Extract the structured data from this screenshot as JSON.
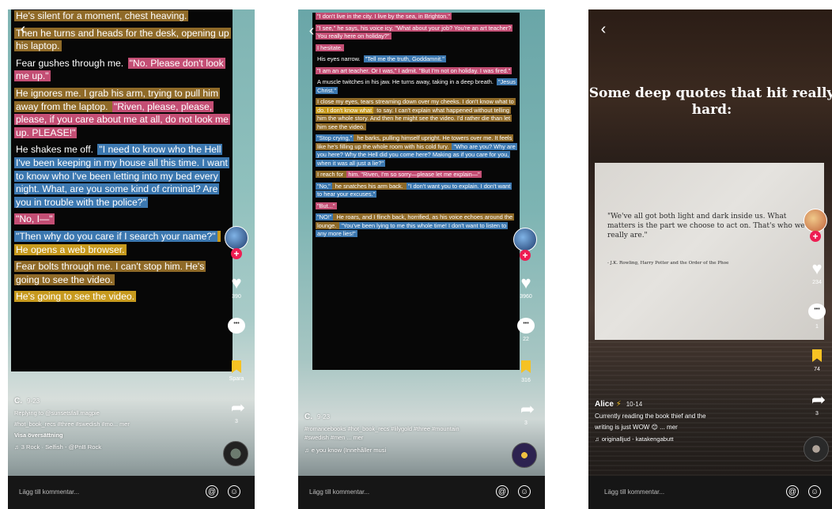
{
  "phones": [
    {
      "text_blocks": [
        {
          "parts": [
            {
              "t": "He's silent for a moment, chest heaving.",
              "hl": "brown"
            }
          ]
        },
        {
          "parts": [
            {
              "t": "Then he turns and heads for the desk, opening up his laptop.",
              "hl": "brown"
            }
          ]
        },
        {
          "parts": [
            {
              "t": "Fear gushes through me. ",
              "hl": "none"
            },
            {
              "t": "\"No. Please don't look me up.\"",
              "hl": "pink"
            }
          ]
        },
        {
          "parts": [
            {
              "t": "He ignores me. I grab his arm, trying to pull him away from the laptop. ",
              "hl": "brown"
            },
            {
              "t": "\"Riven, please, please, please, if you care about me at all, do not look me up. PLEASE!\"",
              "hl": "pink"
            }
          ]
        },
        {
          "parts": [
            {
              "t": "He shakes me off. ",
              "hl": "none"
            },
            {
              "t": "\"I need to know who the Hell I've been keeping in my house all this time. I want to know who I've been letting into my bed every night. What, are you some kind of criminal? Are you in trouble with the police?\"",
              "hl": "blue"
            }
          ]
        },
        {
          "parts": [
            {
              "t": "\"No, I—\"",
              "hl": "pink"
            }
          ]
        },
        {
          "parts": [
            {
              "t": "\"Then why do you care if I search your name?\"",
              "hl": "blue"
            },
            {
              "t": " He opens a web browser.",
              "hl": "yellow"
            }
          ]
        },
        {
          "parts": [
            {
              "t": "Fear bolts through me. I can't stop him. He's going to see the video.",
              "hl": "brown"
            }
          ]
        },
        {
          "parts": [
            {
              "t": "He's going to see the video.",
              "hl": "yellow"
            }
          ]
        }
      ],
      "likes": "390",
      "comments": "",
      "bookmarks": "Spara",
      "shares": "3",
      "author": "C.",
      "date": "9-23",
      "reply_line": "Replying to @sunsetsfall.magpie",
      "caption": "#hot_book_recs #three #swedish #mo... mer",
      "translate": "Visa översättning",
      "music": "3 Rock · Selfish - @PnB Rock",
      "comment_placeholder": "Lägg till kommentar...",
      "at_icon": "@",
      "emoji_icon": "☺"
    },
    {
      "text_blocks": [
        {
          "parts": [
            {
              "t": "\"I don't live in the city. I live by the sea, in Brighton.\"",
              "hl": "pink"
            }
          ]
        },
        {
          "parts": [
            {
              "t": "\"I see,\" he says, his voice icy. \"What about your job? You're an art teacher? You really here on holiday?\"",
              "hl": "pink"
            }
          ]
        },
        {
          "parts": [
            {
              "t": "I hesitate.",
              "hl": "pink"
            }
          ]
        },
        {
          "parts": [
            {
              "t": "His eyes narrow. ",
              "hl": "none"
            },
            {
              "t": "\"Tell me the truth, Goddamnit.\"",
              "hl": "blue"
            }
          ]
        },
        {
          "parts": [
            {
              "t": "\"I am an art teacher. Or I was,\" I admit. \"But I'm not on holiday. I was fired.\"",
              "hl": "pink"
            }
          ]
        },
        {
          "parts": [
            {
              "t": "A muscle twitches in his jaw. He turns away, taking in a deep breath. ",
              "hl": "none"
            },
            {
              "t": "\"Jesus Christ.\"",
              "hl": "blue"
            }
          ]
        },
        {
          "parts": [
            {
              "t": "I close my eyes, tears streaming down over my cheeks. I don't know what to ",
              "hl": "brown"
            },
            {
              "t": "do. I don't know what",
              "hl": "yellow"
            },
            {
              "t": " to say. I can't explain what happened without telling him the whole story. And then he might see the video. I'd rather die than let him see the video.",
              "hl": "brown"
            }
          ]
        },
        {
          "parts": [
            {
              "t": "\"Stop crying,\"",
              "hl": "blue"
            },
            {
              "t": " he barks, pulling himself upright. He towers over me. It feels like he's filling up the whole room with his cold fury. ",
              "hl": "brown"
            },
            {
              "t": "\"Who are you? Why are you here? Why the Hell did you come here? Making as if you care for you, when it was all just a lie?\"",
              "hl": "blue"
            }
          ]
        },
        {
          "parts": [
            {
              "t": "I reach for ",
              "hl": "brown"
            },
            {
              "t": "him. \"Riven, I'm so sorry—please let me explain—\"",
              "hl": "pink"
            }
          ]
        },
        {
          "parts": [
            {
              "t": "\"No,\"",
              "hl": "blue"
            },
            {
              "t": " he snatches his arm back. ",
              "hl": "brown"
            },
            {
              "t": "\"I don't want you to explain. I don't want to hear your excuses.\"",
              "hl": "blue"
            }
          ]
        },
        {
          "parts": [
            {
              "t": "\"But...\"",
              "hl": "pink"
            }
          ]
        },
        {
          "parts": [
            {
              "t": "\"NO!\"",
              "hl": "blue"
            },
            {
              "t": " He roars, and I flinch back, horrified, as his voice echoes around the lounge. ",
              "hl": "brown"
            },
            {
              "t": "\"You've been lying to me this whole time! I don't want to listen to any more lies!\"",
              "hl": "blue"
            }
          ]
        }
      ],
      "likes": "3960",
      "comments": "22",
      "bookmarks": "316",
      "shares": "3",
      "author": "C.",
      "date": "9-23",
      "caption": "#romancebooks #hot_book_recs #lilygold #three #mountain #swedish #men ... mer",
      "music": "e you know (Innehåller musi",
      "comment_placeholder": "Lägg till kommentar...",
      "at_icon": "@",
      "emoji_icon": "☺"
    },
    {
      "title": "Some deep quotes that hit really hard:",
      "quote": "\"We've all got both light and dark inside us. What matters is the part we choose to act on. That's who we really are.\"",
      "quote_source": "- J.K. Rowling, Harry Potter and the Order of the Phoe",
      "likes": "234",
      "comments": "1",
      "bookmarks": "74",
      "shares": "3",
      "author": "Alice",
      "author_emoji": "⚡",
      "date": "10-14",
      "caption_line1": "Currently reading the book thief and the",
      "caption_line2": "writing is just WOW",
      "caption_emoji": "😊",
      "caption_more": "... mer",
      "music": "originalljud - katakengabutt",
      "comment_placeholder": "Lägg till kommentar...",
      "at_icon": "@",
      "emoji_icon": "☺"
    }
  ],
  "icons": {
    "back": "‹",
    "heart": "♥",
    "share": "➦",
    "music_note": "♫",
    "comment_dots": "•••",
    "plus": "+"
  },
  "colors": {
    "highlight_brown": "#8f6a28",
    "highlight_pink": "#c34e74",
    "highlight_blue": "#3c78b0",
    "highlight_yellow": "#c79a1e",
    "bookmark_yellow": "#f6c223",
    "follow_red": "#ee1d52",
    "comment_bar": "#161616"
  }
}
